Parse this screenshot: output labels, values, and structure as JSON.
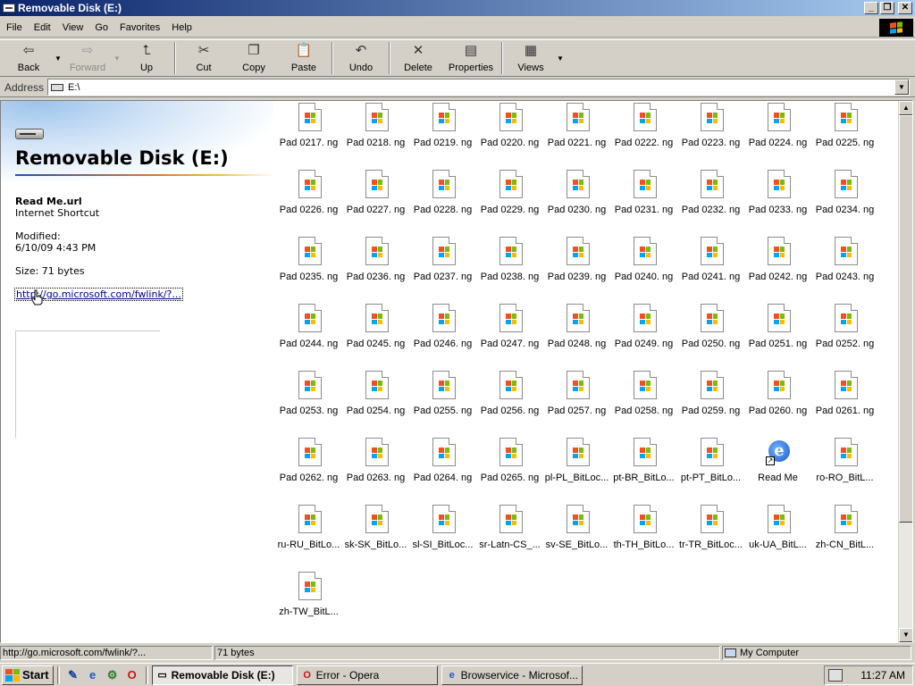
{
  "window": {
    "title": "Removable Disk (E:)",
    "controls": {
      "minimize": "_",
      "maximize": "❐",
      "close": "✕"
    }
  },
  "menu": [
    "File",
    "Edit",
    "View",
    "Go",
    "Favorites",
    "Help"
  ],
  "toolbar": {
    "back": "Back",
    "forward": "Forward",
    "up": "Up",
    "cut": "Cut",
    "copy": "Copy",
    "paste": "Paste",
    "undo": "Undo",
    "delete": "Delete",
    "properties": "Properties",
    "views": "Views"
  },
  "address": {
    "label": "Address",
    "value": "E:\\"
  },
  "left_pane": {
    "title": "Removable Disk (E:)",
    "selected_name": "Read Me.url",
    "selected_type": "Internet Shortcut",
    "modified_label": "Modified:",
    "modified_value": "6/10/09 4:43 PM",
    "size": "Size: 71 bytes",
    "link": "http://go.microsoft.com/fwlink/?..."
  },
  "files": [
    "Pad 0217. ng",
    "Pad 0218. ng",
    "Pad 0219. ng",
    "Pad 0220. ng",
    "Pad 0221. ng",
    "Pad 0222. ng",
    "Pad 0223. ng",
    "Pad 0224. ng",
    "Pad 0225. ng",
    "Pad 0226. ng",
    "Pad 0227. ng",
    "Pad 0228. ng",
    "Pad 0229. ng",
    "Pad 0230. ng",
    "Pad 0231. ng",
    "Pad 0232. ng",
    "Pad 0233. ng",
    "Pad 0234. ng",
    "Pad 0235. ng",
    "Pad 0236. ng",
    "Pad 0237. ng",
    "Pad 0238. ng",
    "Pad 0239. ng",
    "Pad 0240. ng",
    "Pad 0241. ng",
    "Pad 0242. ng",
    "Pad 0243. ng",
    "Pad 0244. ng",
    "Pad 0245. ng",
    "Pad 0246. ng",
    "Pad 0247. ng",
    "Pad 0248. ng",
    "Pad 0249. ng",
    "Pad 0250. ng",
    "Pad 0251. ng",
    "Pad 0252. ng",
    "Pad 0253. ng",
    "Pad 0254. ng",
    "Pad 0255. ng",
    "Pad 0256. ng",
    "Pad 0257. ng",
    "Pad 0258. ng",
    "Pad 0259. ng",
    "Pad 0260. ng",
    "Pad 0261. ng",
    "Pad 0262. ng",
    "Pad 0263. ng",
    "Pad 0264. ng",
    "Pad 0265. ng",
    "pl-PL_BitLoc...",
    "pt-BR_BitLo...",
    "pt-PT_BitLo...",
    "Read Me",
    "ro-RO_BitL...",
    "ru-RU_BitLo...",
    "sk-SK_BitLo...",
    "sl-SI_BitLoc...",
    "sr-Latn-CS_...",
    "sv-SE_BitLo...",
    "th-TH_BitLo...",
    "tr-TR_BitLoc...",
    "uk-UA_BitL...",
    "zh-CN_BitL...",
    "zh-TW_BitL..."
  ],
  "status": {
    "url": "http://go.microsoft.com/fwlink/?...",
    "size": "71 bytes",
    "zone": "My Computer"
  },
  "taskbar": {
    "start": "Start",
    "tasks": [
      "Removable Disk (E:)",
      "Error - Opera",
      "Browservice - Microsof..."
    ],
    "clock": "11:27 AM"
  },
  "colors": {
    "title_bar": "#0a246a",
    "link": "#00008b",
    "win_red": "#f25022",
    "win_green": "#7fba00",
    "win_blue": "#00a4ef",
    "win_yellow": "#ffb900"
  }
}
